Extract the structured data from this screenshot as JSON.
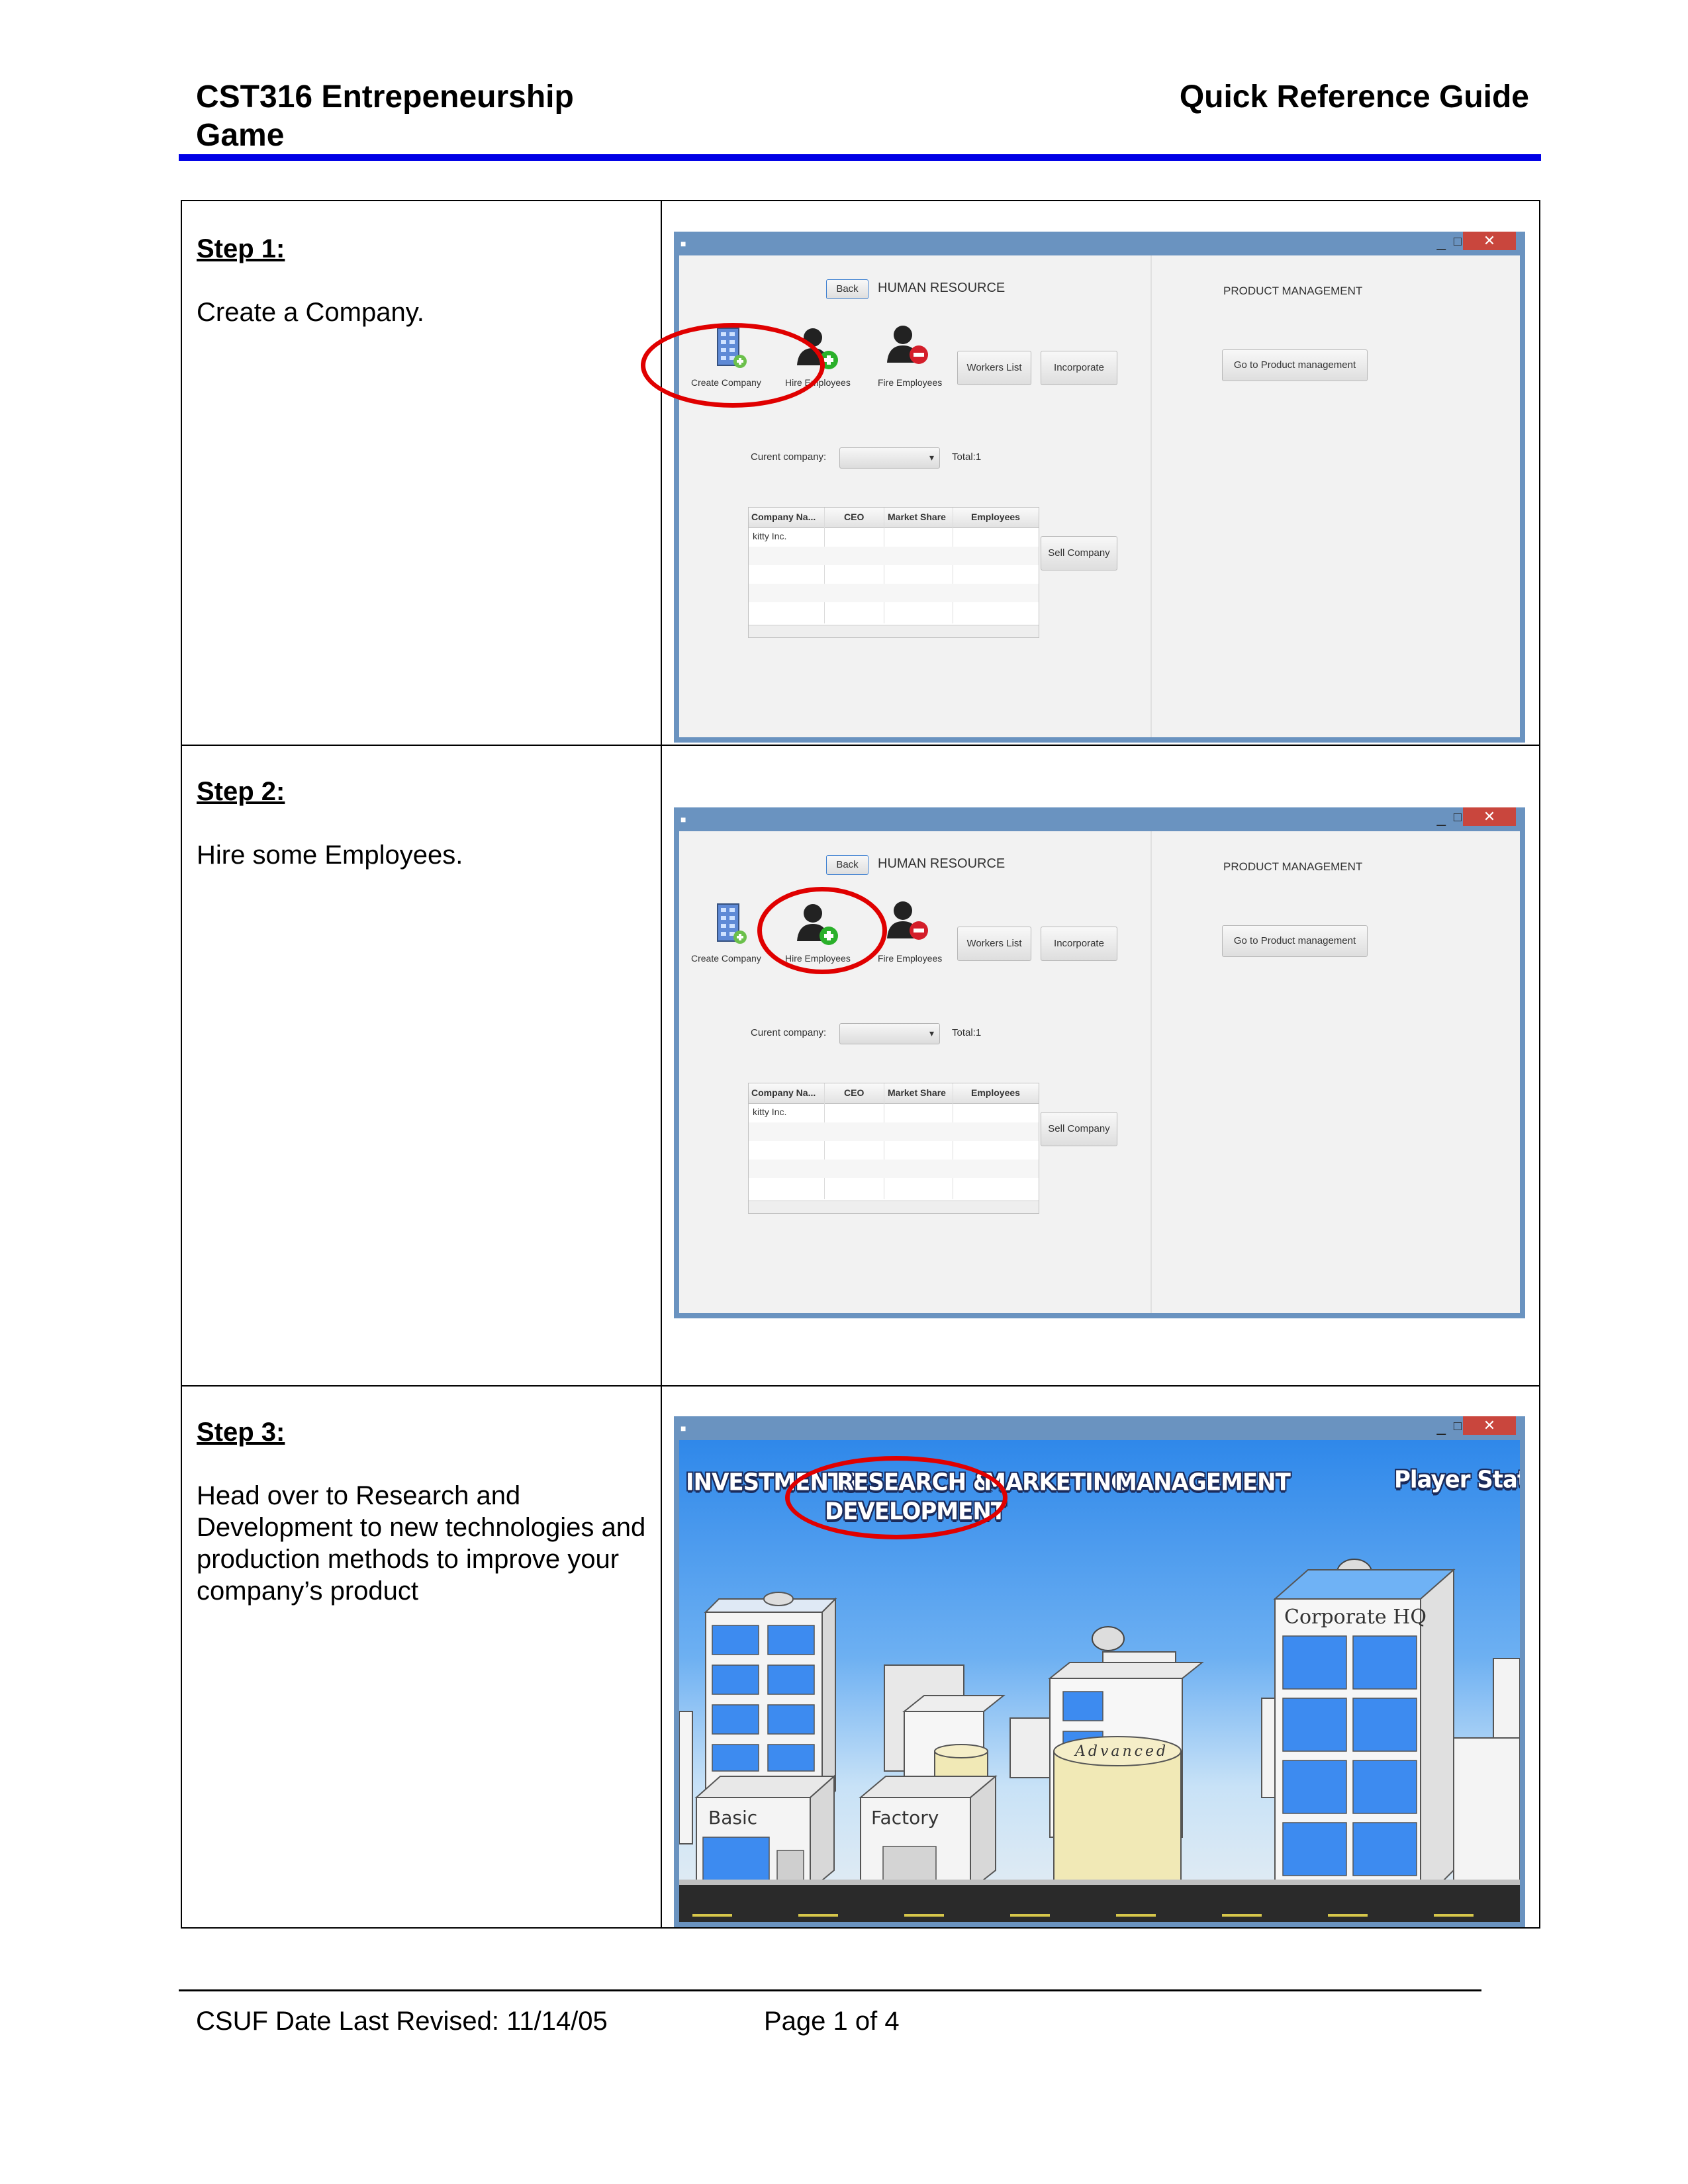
{
  "header": {
    "title_line1": "CST316 Entrepeneurship",
    "title_line2": "Game",
    "right_title": "Quick Reference Guide"
  },
  "steps": [
    {
      "title": "Step 1:",
      "description": "Create a Company."
    },
    {
      "title": "Step 2:",
      "description": "Hire some Employees."
    },
    {
      "title": "Step 3:",
      "description": "Head over to Research and Development to new technologies and production methods to improve your company’s product"
    }
  ],
  "app_window": {
    "window_controls": {
      "minimize": "_",
      "maximize": "□",
      "close": "✕"
    },
    "back_label": "Back",
    "hr_title": "HUMAN RESOURCE",
    "pm_title": "PRODUCT MANAGEMENT",
    "pm_button": "Go to Product management",
    "icons": [
      {
        "icon": "building-add-icon",
        "label": "Create Company"
      },
      {
        "icon": "user-add-icon",
        "label": "Hire Employees"
      },
      {
        "icon": "user-remove-icon",
        "label": "Fire Employees"
      }
    ],
    "workers_list": "Workers List",
    "incorporate": "Incorporate",
    "current_company_label": "Curent company:",
    "total_label": "Total:1",
    "sell_company": "Sell Company",
    "table": {
      "columns": [
        "Company Na...",
        "CEO",
        "Market Share",
        "Employees"
      ],
      "rows": [
        [
          "kitty Inc.",
          "",
          "",
          ""
        ]
      ]
    }
  },
  "game_window": {
    "menu": [
      "INVESTMENTS",
      "RESEARCH &",
      "DEVELOPMENT",
      "MARKETING",
      "MANAGEMENT"
    ],
    "player_status": "Player Status",
    "buildings": {
      "hq": "Corporate HQ",
      "basic": "Basic",
      "factory": "Factory",
      "advanced": "Advanced"
    }
  },
  "highlight_color": "#e00000",
  "accent_rule_color": "#0000e6",
  "footer": {
    "left": "CSUF Date Last Revised: 11/14/05",
    "page": "Page 1 of 4"
  }
}
